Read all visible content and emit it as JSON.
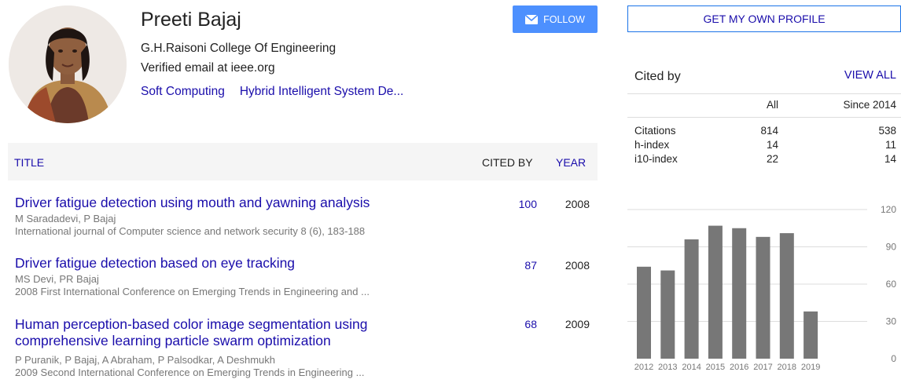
{
  "profile": {
    "name": "Preeti Bajaj",
    "affiliation": "G.H.Raisoni College Of Engineering",
    "email": "Verified email at ieee.org",
    "interests": [
      "Soft Computing",
      "Hybrid Intelligent System De..."
    ],
    "follow_label": "FOLLOW"
  },
  "table": {
    "header": {
      "title": "TITLE",
      "cited_by": "CITED BY",
      "year": "YEAR"
    },
    "articles": [
      {
        "title": "Driver fatigue detection using mouth and yawning analysis",
        "authors": "M Saradadevi, P Bajaj",
        "venue": "International journal of Computer science and network security 8 (6), 183-188",
        "cited_by": "100",
        "year": "2008"
      },
      {
        "title": "Driver fatigue detection based on eye tracking",
        "authors": "MS Devi, PR Bajaj",
        "venue": "2008 First International Conference on Emerging Trends in Engineering and ...",
        "cited_by": "87",
        "year": "2008"
      },
      {
        "title": "Human perception-based color image segmentation using comprehensive learning particle swarm optimization",
        "authors": "P Puranik, P Bajaj, A Abraham, P Palsodkar, A Deshmukh",
        "venue": "2009 Second International Conference on Emerging Trends in Engineering ...",
        "cited_by": "68",
        "year": "2009"
      }
    ]
  },
  "sidebar": {
    "get_profile_label": "GET MY OWN PROFILE",
    "cited_by_title": "Cited by",
    "view_all_label": "VIEW ALL",
    "col_all": "All",
    "col_since": "Since 2014",
    "stats": [
      {
        "label": "Citations",
        "all": "814",
        "since": "538"
      },
      {
        "label": "h-index",
        "all": "14",
        "since": "11"
      },
      {
        "label": "i10-index",
        "all": "22",
        "since": "14"
      }
    ]
  },
  "chart_data": {
    "type": "bar",
    "categories": [
      "2012",
      "2013",
      "2014",
      "2015",
      "2016",
      "2017",
      "2018",
      "2019"
    ],
    "values": [
      74,
      71,
      96,
      107,
      105,
      98,
      101,
      38
    ],
    "yticks": [
      0,
      30,
      60,
      90,
      120
    ],
    "ylim": [
      0,
      120
    ],
    "bar_color": "#777777"
  },
  "colors": {
    "link": "#1a0dab",
    "button": "#4d90fe"
  }
}
